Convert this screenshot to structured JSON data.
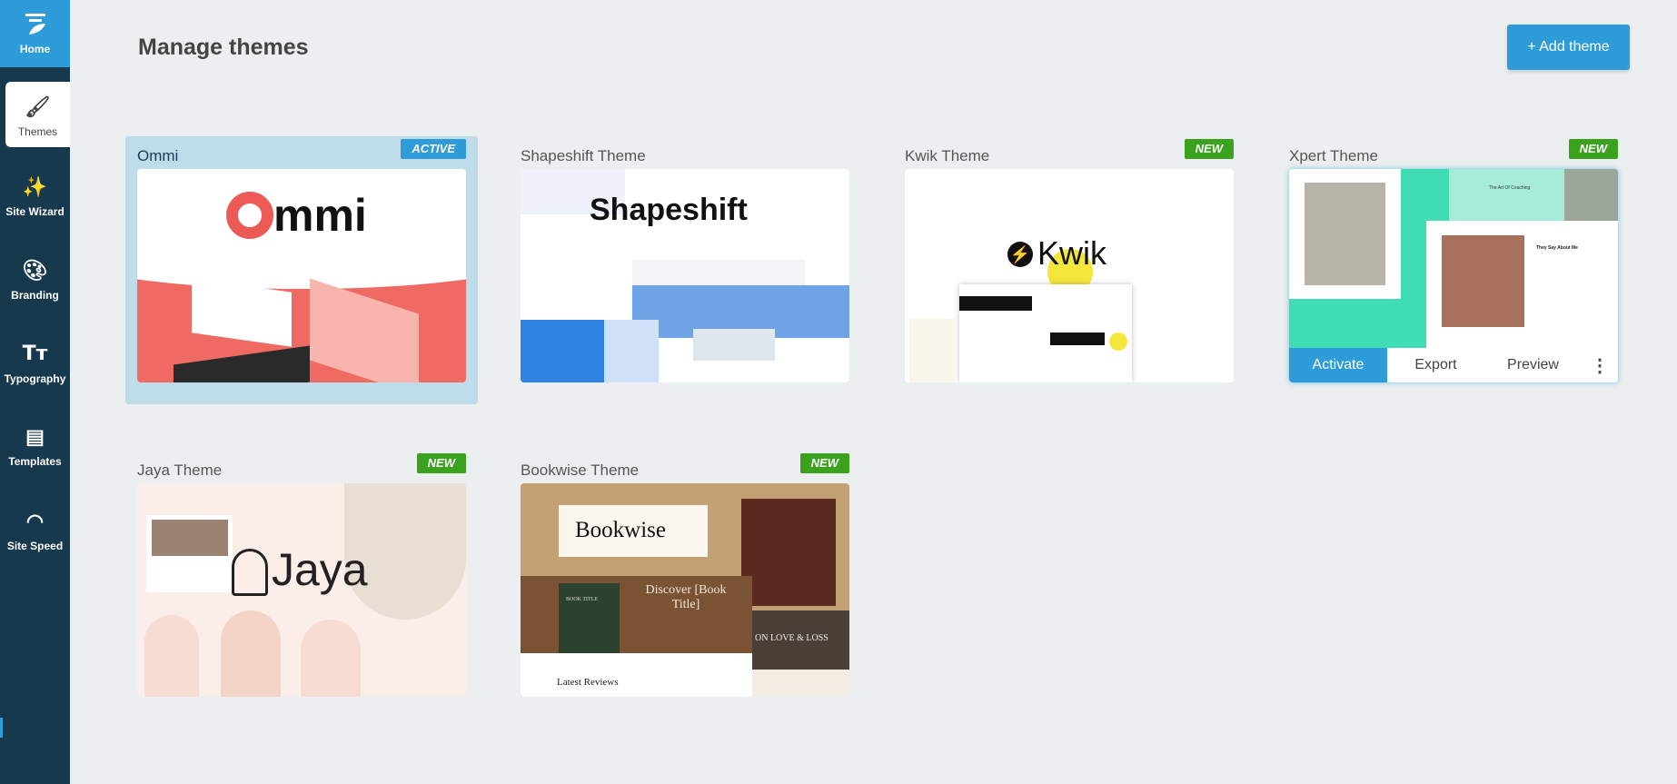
{
  "sidebar": {
    "items": [
      {
        "label": "Home",
        "icon": "home-logo-icon"
      },
      {
        "label": "Themes",
        "icon": "themes-brush-icon"
      },
      {
        "label": "Site Wizard",
        "icon": "magic-wand-icon"
      },
      {
        "label": "Branding",
        "icon": "palette-icon"
      },
      {
        "label": "Typography",
        "icon": "typography-icon"
      },
      {
        "label": "Templates",
        "icon": "templates-icon"
      },
      {
        "label": "Site Speed",
        "icon": "speedometer-icon"
      }
    ],
    "active": "Themes"
  },
  "header": {
    "title": "Manage themes",
    "add_label": "+ Add theme"
  },
  "colors": {
    "accent": "#2d9cd9",
    "sidebar": "#16394d",
    "new_badge": "#3aa21c",
    "active_card": "#bedcea"
  },
  "themes": [
    {
      "name": "Ommi",
      "badge": "ACTIVE",
      "logo": "mmi"
    },
    {
      "name": "Shapeshift Theme",
      "badge": "",
      "logo": "Shapeshift"
    },
    {
      "name": "Kwik Theme",
      "badge": "NEW",
      "logo": "Kwik"
    },
    {
      "name": "Xpert Theme",
      "badge": "NEW",
      "preview_text": "The Art Of Coaching",
      "preview_text2": "They Say About Me"
    },
    {
      "name": "Jaya Theme",
      "badge": "NEW",
      "logo": "Jaya"
    },
    {
      "name": "Bookwise Theme",
      "badge": "NEW",
      "logo": "Bookwise",
      "hero": "Discover [Book Title]",
      "book": "BOOK TITLE",
      "section": "Latest Reviews",
      "banner": "ON LOVE & LOSS"
    }
  ],
  "hover_actions": {
    "activate": "Activate",
    "export": "Export",
    "preview": "Preview",
    "more": "⋮"
  }
}
